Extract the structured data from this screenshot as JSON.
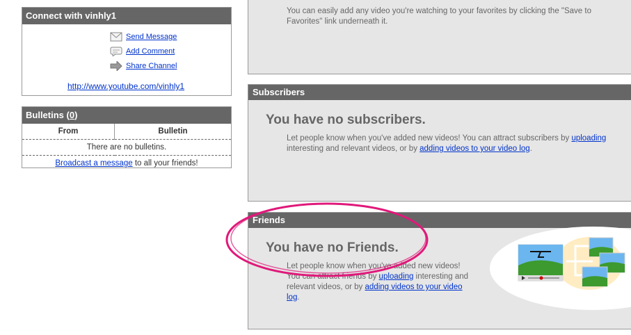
{
  "connect": {
    "title": "Connect with vinhly1",
    "send_message": "Send Message",
    "add_comment": "Add Comment",
    "share_channel": "Share Channel",
    "channel_url": "http://www.youtube.com/vinhly1"
  },
  "bulletins": {
    "title_prefix": "Bulletins (",
    "count": "0",
    "title_suffix": ")",
    "col_from": "From",
    "col_bulletin": "Bulletin",
    "empty": "There are no bulletins.",
    "broadcast_link": "Broadcast a message",
    "broadcast_suffix": " to all your friends!"
  },
  "favorites": {
    "text": "You can easily add any video you're watching to your favorites by clicking the \"Save to Favorites\" link underneath it."
  },
  "subscribers": {
    "title": "Subscribers",
    "heading": "You have no subscribers.",
    "text1": "Let people know when you've added new videos! You can attract subscribers by ",
    "link1": "uploading",
    "text2": " interesting and relevant videos, or by ",
    "link2": "adding videos to your video log",
    "text3": "."
  },
  "friends": {
    "title": "Friends",
    "heading": "You have no Friends.",
    "text1": "Let people know when you've added new videos! You can attract friends by ",
    "link1": "uploading",
    "text2": " interesting and relevant videos, or by ",
    "link2": "adding videos to your video log",
    "text3": "."
  },
  "colors": {
    "header_bg": "#666666",
    "panel_bg": "#e6e6e6",
    "link": "#0033cc",
    "annotation": "#e0197a"
  }
}
